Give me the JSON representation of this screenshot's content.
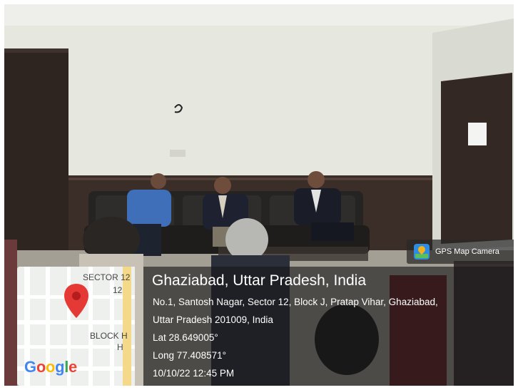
{
  "badge": {
    "icon": "gps-map-camera-app-icon",
    "label": "GPS Map Camera"
  },
  "location": {
    "title": "Ghaziabad, Uttar Pradesh, India",
    "address_line1": "No.1, Santosh Nagar, Sector 12, Block J, Pratap Vihar, Ghaziabad,",
    "address_line2": "Uttar Pradesh 201009, India",
    "lat": "Lat 28.649005°",
    "long": "Long 77.408571°",
    "datetime": "10/10/22 12:45 PM"
  },
  "map": {
    "label_sector": "SECTOR 12",
    "label_sector_num": "12",
    "label_block": "BLOCK H",
    "label_block_letter": "H",
    "pin_icon": "location-pin-icon",
    "logo": "Google",
    "pin_color": "#e53935"
  }
}
